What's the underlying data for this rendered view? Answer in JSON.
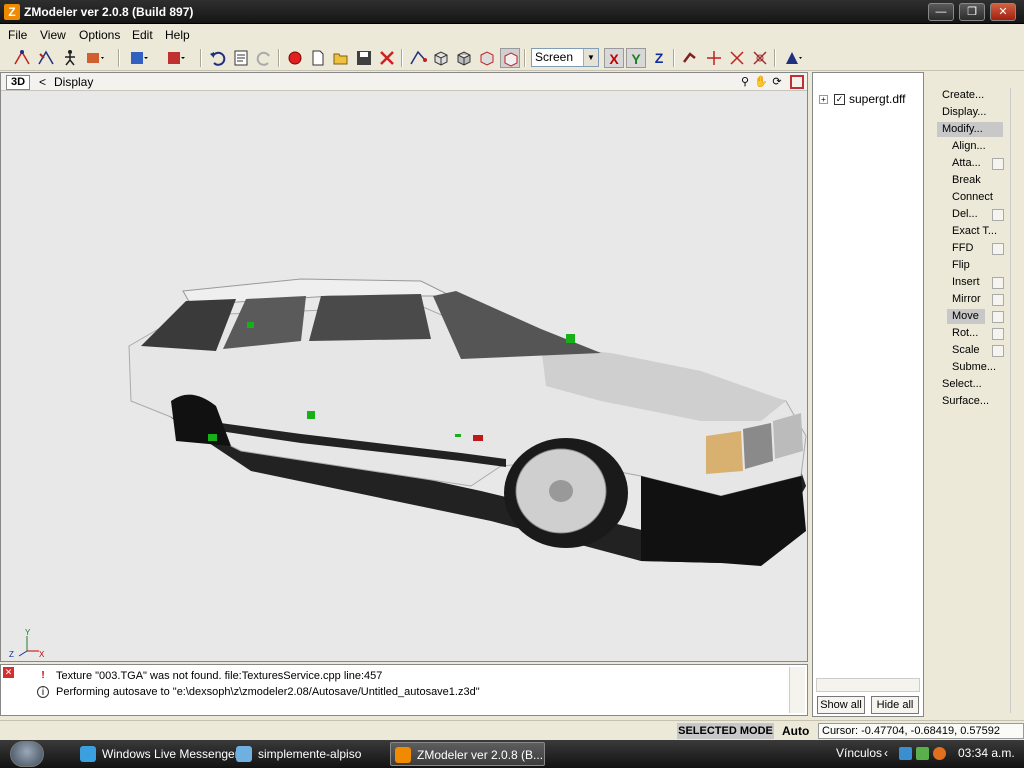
{
  "window": {
    "title": "ZModeler ver 2.0.8 (Build 897)",
    "app_icon_letter": "Z",
    "controls": [
      "minimize",
      "maximize",
      "close"
    ]
  },
  "menu": [
    "File",
    "View",
    "Options",
    "Edit",
    "Help"
  ],
  "toolbar": {
    "coord_system": "Screen",
    "axis_x": "X",
    "axis_y": "Y",
    "axis_z": "Z"
  },
  "viewport": {
    "mode": "3D",
    "back": "<",
    "title": "Display",
    "axis_gizmo": {
      "y": "Y",
      "z": "Z",
      "x": "X"
    }
  },
  "log": [
    {
      "icon": "warning-icon",
      "text": "Texture \"003.TGA\" was not found. file:TexturesService.cpp line:457"
    },
    {
      "icon": "info-icon",
      "text": "Performing autosave to \"e:\\dexsoph\\z\\zmodeler2.08/Autosave/Untitled_autosave1.z3d\""
    }
  ],
  "scene": {
    "item": "supergt.dff",
    "checked": true,
    "show_all": "Show all",
    "hide_all": "Hide all"
  },
  "commands": {
    "top": [
      "Create...",
      "Display...",
      "Modify..."
    ],
    "modify_items": [
      "Align...",
      "Atta...",
      "Break",
      "Connect",
      "Del...",
      "Exact T...",
      "FFD",
      "Flip",
      "Insert",
      "Mirror",
      "Move",
      "Rot...",
      "Scale",
      "Subme..."
    ],
    "bottom": [
      "Select...",
      "Surface..."
    ],
    "active": "Move"
  },
  "status": {
    "mode": "SELECTED MODE",
    "auto": "Auto",
    "cursor": "Cursor: -0.47704, -0.68419, 0.57592"
  },
  "taskbar": {
    "tasks": [
      "Windows Live Messenger",
      "simplemente-alpiso",
      "ZModeler ver 2.0.8 (B..."
    ],
    "active_task": "ZModeler ver 2.0.8 (B...",
    "tray_label": "Vínculos",
    "clock": "03:34 a.m."
  },
  "colors": {
    "viewport_bg": "#e8e8e8",
    "car_body": "#e6e6e6",
    "selection_marker": "#18b018",
    "axis_x": "#c00000",
    "axis_y": "#208020",
    "axis_z": "#1030a0"
  }
}
